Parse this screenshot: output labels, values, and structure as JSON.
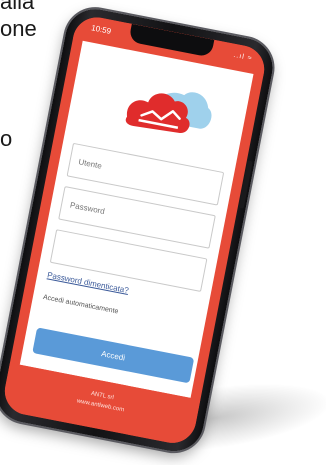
{
  "background_text": {
    "line1": "alla",
    "line2": "one",
    "line3": "o"
  },
  "status_bar": {
    "time": "10:59",
    "icons": "..ıl ≈"
  },
  "login": {
    "username_placeholder": "Utente",
    "password_placeholder": "Password",
    "third_placeholder": "",
    "forgot_password": "Password dimenticata?",
    "auto_login": "Accedi automaticamente",
    "submit": "Accedi"
  },
  "footer": {
    "line1": "ANTL srl",
    "line2": "www.antlweb.com"
  },
  "colors": {
    "brand_red": "#e74b38",
    "cloud_blue": "#9fd1ec",
    "button_blue": "#5a9ad8",
    "link_blue": "#3b5a9a"
  }
}
